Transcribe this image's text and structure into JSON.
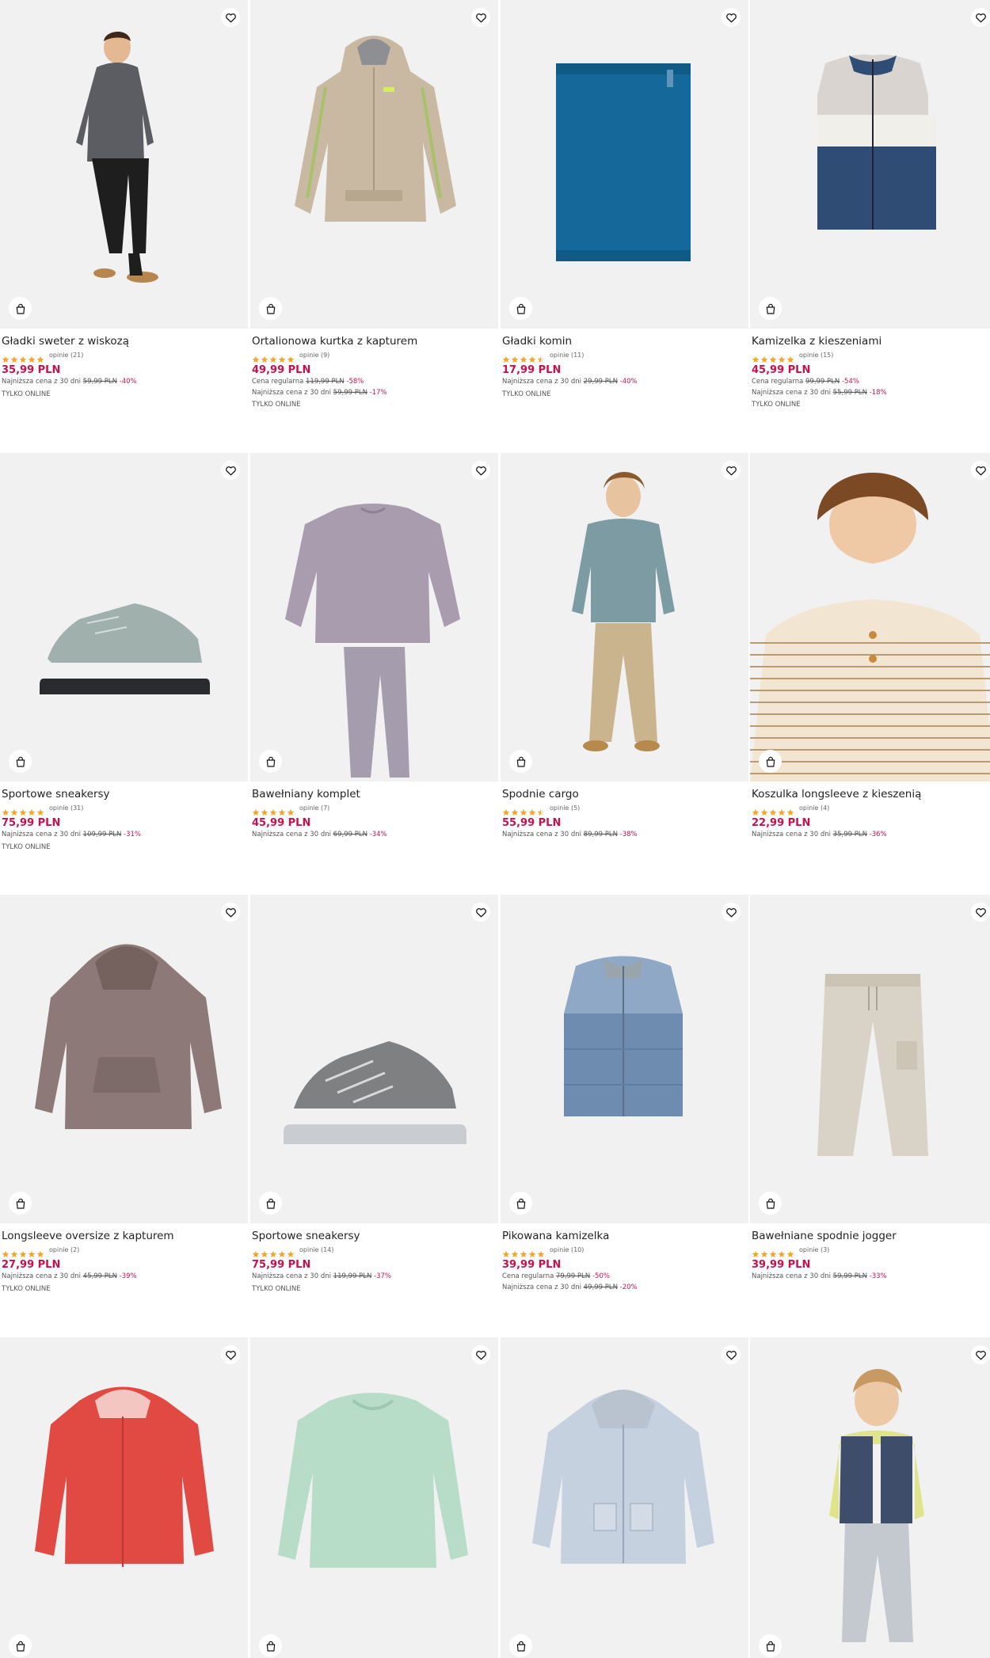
{
  "icons": {
    "favorite": "heart-outline-icon",
    "bag": "shopping-bag-icon",
    "star": "star-icon"
  },
  "colors": {
    "price": "#c4124f",
    "star": "#f5a623",
    "photo_bg": "#f1f1f2"
  },
  "products": [
    {
      "name": "Gładki sweter z wiskozą",
      "rating": 5,
      "reviews": "opinie (21)",
      "price": "35,99 PLN",
      "lines": [
        {
          "prefix": "Najniższa cena z 30 dni",
          "old": "59,99 PLN",
          "disc": "-40%"
        }
      ],
      "badge": "TYLKO ONLINE",
      "art": "boy-sweater"
    },
    {
      "name": "Ortalionowa kurtka z kapturem",
      "rating": 5,
      "reviews": "opinie (9)",
      "price": "49,99 PLN",
      "lines": [
        {
          "prefix": "Cena regularna",
          "old": "119,99 PLN",
          "disc": "-58%"
        },
        {
          "prefix": "Najniższa cena z 30 dni",
          "old": "59,99 PLN",
          "disc": "-17%"
        }
      ],
      "badge": "TYLKO ONLINE",
      "art": "jacket-beige"
    },
    {
      "name": "Gładki komin",
      "rating": 4.5,
      "reviews": "opinie (11)",
      "price": "17,99 PLN",
      "lines": [
        {
          "prefix": "Najniższa cena z 30 dni",
          "old": "29,99 PLN",
          "disc": "-40%"
        }
      ],
      "badge": "TYLKO ONLINE",
      "art": "snood"
    },
    {
      "name": "Kamizelka z kieszeniami",
      "rating": 5,
      "reviews": "opinie (15)",
      "price": "45,99 PLN",
      "lines": [
        {
          "prefix": "Cena regularna",
          "old": "99,99 PLN",
          "disc": "-54%"
        },
        {
          "prefix": "Najniższa cena z 30 dni",
          "old": "55,99 PLN",
          "disc": "-18%"
        }
      ],
      "badge": "TYLKO ONLINE",
      "art": "vest-colorblock"
    },
    {
      "name": "Sportowe sneakersy",
      "rating": 5,
      "reviews": "opinie (31)",
      "price": "75,99 PLN",
      "lines": [
        {
          "prefix": "Najniższa cena z 30 dni",
          "old": "109,99 PLN",
          "disc": "-31%"
        }
      ],
      "badge": "TYLKO ONLINE",
      "art": "sneaker-grey"
    },
    {
      "name": "Bawełniany komplet",
      "rating": 5,
      "reviews": "opinie (7)",
      "price": "45,99 PLN",
      "lines": [
        {
          "prefix": "Najniższa cena z 30 dni",
          "old": "69,99 PLN",
          "disc": "-34%"
        }
      ],
      "badge": "",
      "art": "set-lilac"
    },
    {
      "name": "Spodnie cargo",
      "rating": 4.5,
      "reviews": "opinie (5)",
      "price": "55,99 PLN",
      "lines": [
        {
          "prefix": "Najniższa cena z 30 dni",
          "old": "89,99 PLN",
          "disc": "-38%"
        }
      ],
      "badge": "",
      "art": "boy-cargo"
    },
    {
      "name": "Koszulka longsleeve z kieszenią",
      "rating": 5,
      "reviews": "opinie (4)",
      "price": "22,99 PLN",
      "lines": [
        {
          "prefix": "Najniższa cena z 30 dni",
          "old": "35,99 PLN",
          "disc": "-36%"
        }
      ],
      "badge": "",
      "art": "boy-stripes"
    },
    {
      "name": "Longsleeve oversize z kapturem",
      "rating": 5,
      "reviews": "opinie (2)",
      "price": "27,99 PLN",
      "lines": [
        {
          "prefix": "Najniższa cena z 30 dni",
          "old": "45,99 PLN",
          "disc": "-39%"
        }
      ],
      "badge": "TYLKO ONLINE",
      "art": "hoodie-mauve"
    },
    {
      "name": "Sportowe sneakersy",
      "rating": 5,
      "reviews": "opinie (14)",
      "price": "75,99 PLN",
      "lines": [
        {
          "prefix": "Najniższa cena z 30 dni",
          "old": "119,99 PLN",
          "disc": "-37%"
        }
      ],
      "badge": "TYLKO ONLINE",
      "art": "sneaker-trail"
    },
    {
      "name": "Pikowana kamizelka",
      "rating": 5,
      "reviews": "opinie (10)",
      "price": "39,99 PLN",
      "lines": [
        {
          "prefix": "Cena regularna",
          "old": "79,99 PLN",
          "disc": "-50%"
        },
        {
          "prefix": "Najniższa cena z 30 dni",
          "old": "49,99 PLN",
          "disc": "-20%"
        }
      ],
      "badge": "",
      "art": "vest-puffer"
    },
    {
      "name": "Bawełniane spodnie jogger",
      "rating": 5,
      "reviews": "opinie (3)",
      "price": "39,99 PLN",
      "lines": [
        {
          "prefix": "Najniższa cena z 30 dni",
          "old": "59,99 PLN",
          "disc": "-33%"
        }
      ],
      "badge": "",
      "art": "pants-beige"
    },
    {
      "name": "",
      "rating": 0,
      "reviews": "",
      "price": "",
      "lines": [],
      "badge": "",
      "art": "jacket-red"
    },
    {
      "name": "",
      "rating": 0,
      "reviews": "",
      "price": "",
      "lines": [],
      "badge": "",
      "art": "sweater-mint"
    },
    {
      "name": "",
      "rating": 0,
      "reviews": "",
      "price": "",
      "lines": [],
      "badge": "",
      "art": "jacket-quilted"
    },
    {
      "name": "",
      "rating": 0,
      "reviews": "",
      "price": "",
      "lines": [],
      "badge": "",
      "art": "boy-vest"
    }
  ]
}
